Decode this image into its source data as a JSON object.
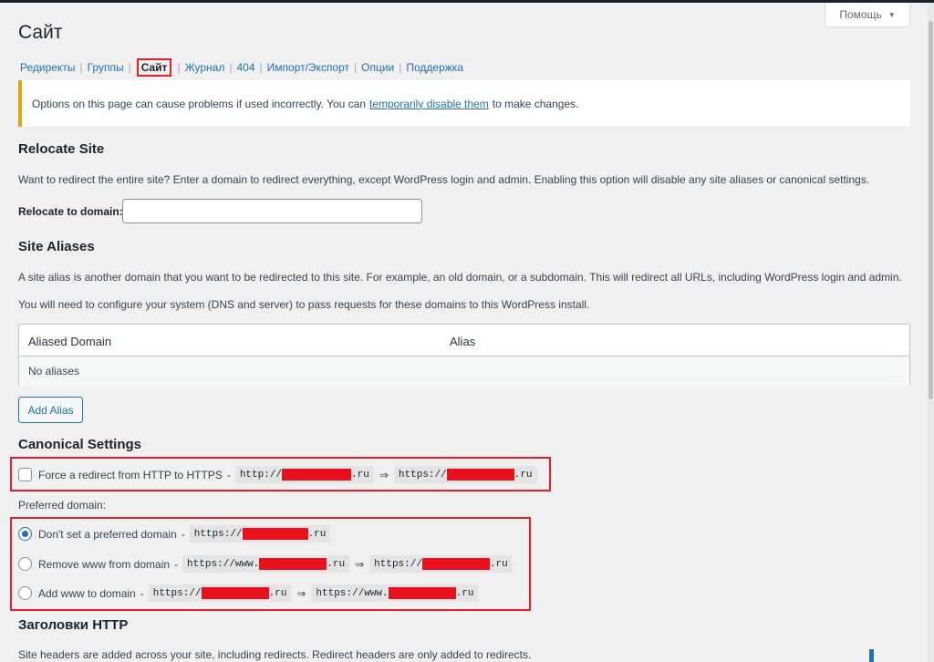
{
  "help": {
    "label": "Помощь",
    "caret": "▼"
  },
  "page_title": "Сайт",
  "subnav": {
    "items": [
      {
        "label": "Редиректы"
      },
      {
        "label": "Группы"
      },
      {
        "label": "Сайт",
        "current": true
      },
      {
        "label": "Журнал"
      },
      {
        "label": "404"
      },
      {
        "label": "Импорт/Экспорт"
      },
      {
        "label": "Опции"
      },
      {
        "label": "Поддержка"
      }
    ],
    "separator": "|"
  },
  "notice": {
    "before": "Options on this page can cause problems if used incorrectly. You can",
    "link": "temporarily disable them",
    "after": "to make changes.",
    "border_color": "#dba617"
  },
  "relocate": {
    "heading": "Relocate Site",
    "description": "Want to redirect the entire site? Enter a domain to redirect everything, except WordPress login and admin. Enabling this option will disable any site aliases or canonical settings.",
    "label": "Relocate to domain:",
    "value": ""
  },
  "aliases": {
    "heading": "Site Aliases",
    "description1": "A site alias is another domain that you want to be redirected to this site. For example, an old domain, or a subdomain. This will redirect all URLs, including WordPress login and admin.",
    "description2": "You will need to configure your system (DNS and server) to pass requests for these domains to this WordPress install.",
    "table": {
      "columns": [
        "Aliased Domain",
        "Alias"
      ],
      "empty": "No aliases"
    },
    "add_button": "Add Alias"
  },
  "canonical": {
    "heading": "Canonical Settings",
    "https": {
      "label": "Force a redirect from HTTP to HTTPS",
      "dash": "-",
      "from_prefix": "http://",
      "from_suffix": ".ru",
      "arrow": "⇒",
      "to_prefix": "https://",
      "to_suffix": ".ru",
      "checked": false
    },
    "preferred_label": "Preferred domain:",
    "options": [
      {
        "label": "Don't set a preferred domain",
        "from_prefix": "https://",
        "from_suffix": ".ru",
        "checked": true
      },
      {
        "label": "Remove www from domain",
        "from_prefix": "https://www.",
        "from_suffix": ".ru",
        "to_prefix": "https://",
        "to_suffix": ".ru",
        "checked": false
      },
      {
        "label": "Add www to domain",
        "from_prefix": "https://",
        "from_suffix": ".ru",
        "to_prefix": "https://www.",
        "to_suffix": ".ru",
        "checked": false
      }
    ]
  },
  "http_headers": {
    "heading": "Заголовки HTTP",
    "description": "Site headers are added across your site, including redirects. Redirect headers are only added to redirects."
  },
  "colors": {
    "accent": "#2271b1",
    "highlight": "#e1202a",
    "redaction": "#e8101d"
  }
}
